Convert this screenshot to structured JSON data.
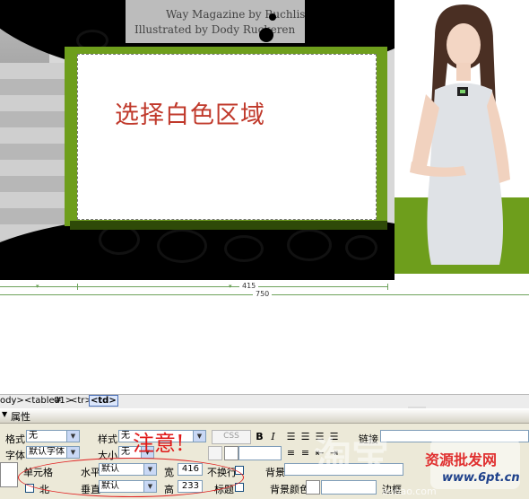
{
  "banner": {
    "credit_line1": "Way Magazine by Ruchlis",
    "credit_line2": "Illustrated by Dody Ruckeren",
    "frame_text": "选择白色区域",
    "accent": "#6e9e1c"
  },
  "ruler": {
    "cell_width": "415",
    "table_width": "750"
  },
  "tagbar": {
    "body": "ody>",
    "table": "<table#",
    "extra": "01>",
    "tr": "<tr>",
    "td": "<td>"
  },
  "properties": {
    "title": "属性",
    "format_label": "格式",
    "format_value": "无",
    "style_label": "样式",
    "style_value": "无",
    "css_label": "CSS",
    "font_label": "字体",
    "font_value": "默认字体",
    "size_label": "大小",
    "size_value": "无",
    "link_label": "链接",
    "cell_label": "单元格",
    "horiz_label": "水平",
    "horiz_value": "默认",
    "width_label": "宽",
    "width_value": "416",
    "nowrap_label": "不换行",
    "bg_label": "背景",
    "vert_label": "垂直",
    "vert_value": "默认",
    "height_label": "高",
    "height_value": "233",
    "header_label": "标题",
    "bgcolor_label": "背景颜色",
    "border_label": "边框"
  },
  "annotation": {
    "note": "注意!"
  },
  "watermark": {
    "left_text": "淘宝",
    "site_url": "www.6pt.cn",
    "logo_text": "资源批发网",
    "bottom_url": "aobao.com"
  }
}
